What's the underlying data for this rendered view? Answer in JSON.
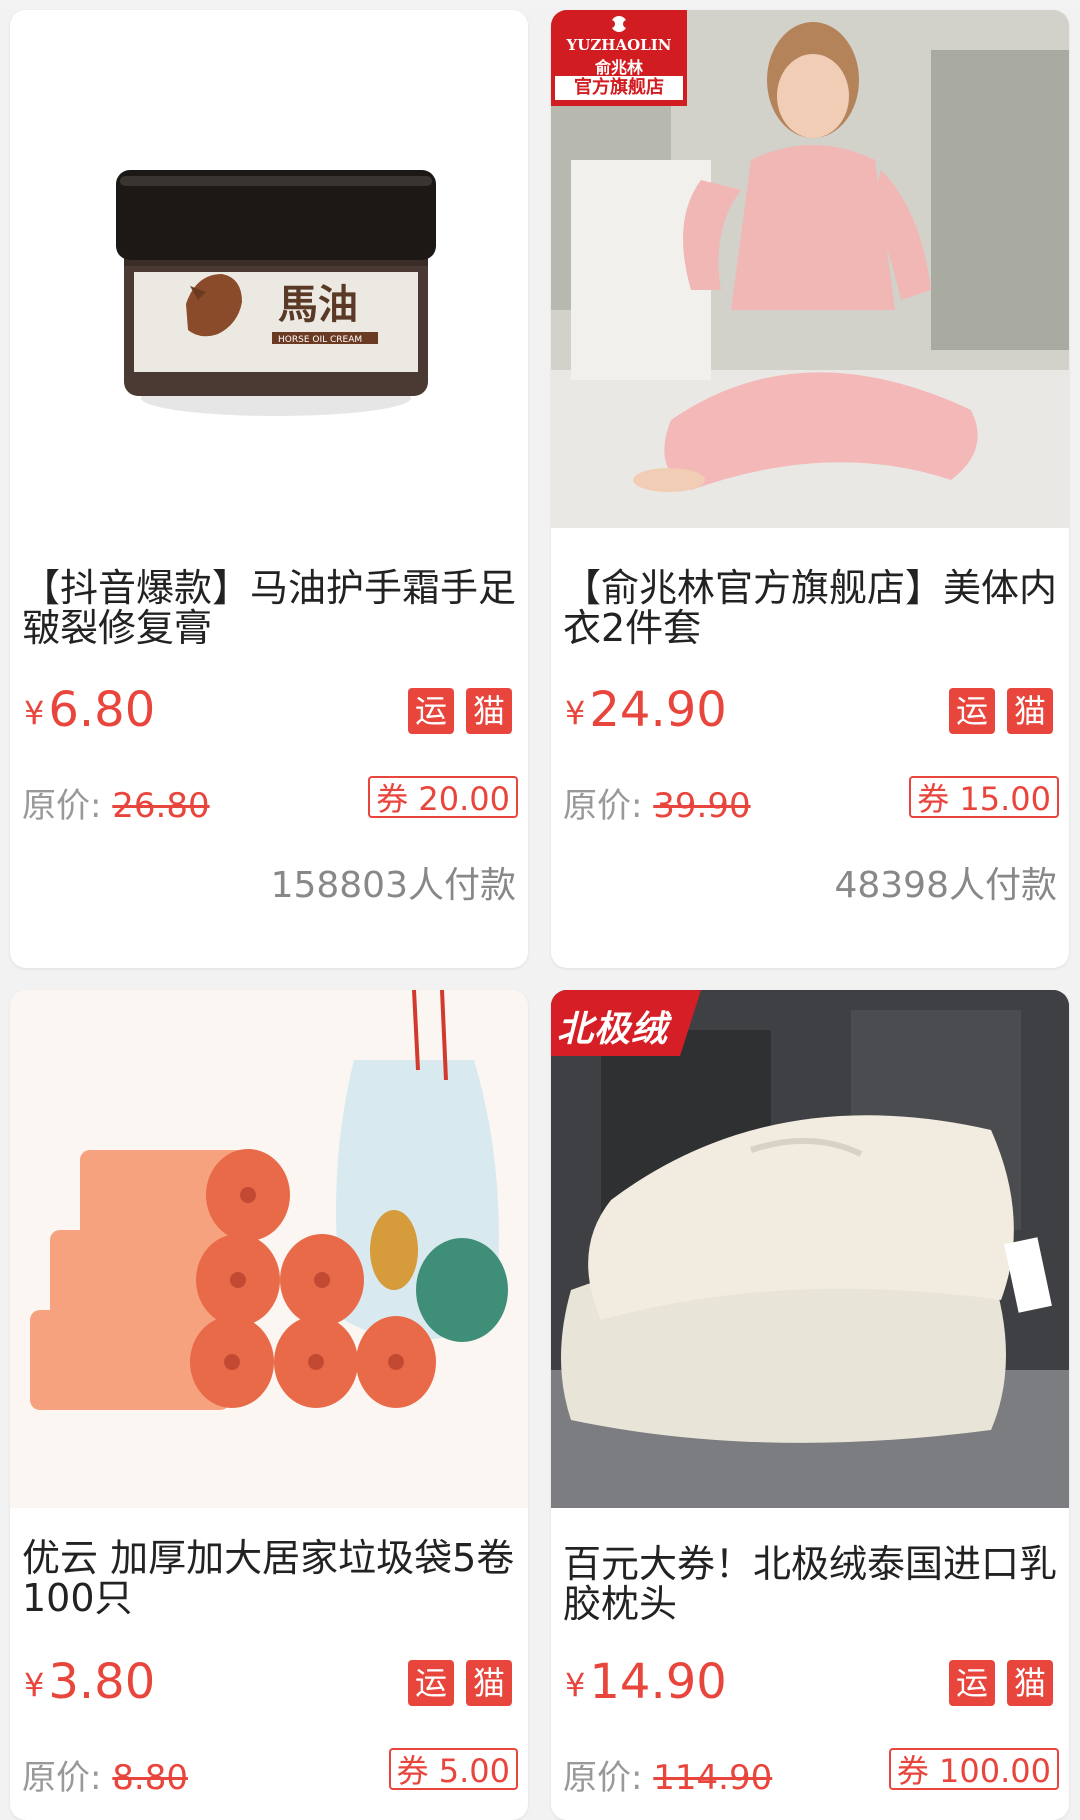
{
  "products": [
    {
      "title": "【抖音爆款】马油护手霜手足皲裂修复膏",
      "currency": "¥",
      "price": "6.80",
      "tags": [
        "运",
        "猫"
      ],
      "orig_label": "原价:",
      "orig_price": "26.80",
      "coupon": "券 20.00",
      "sales": "158803人付款",
      "image_text": "馬油",
      "image_subtext": "HORSE OIL CREAM"
    },
    {
      "title": "【俞兆林官方旗舰店】美体内衣2件套",
      "currency": "¥",
      "price": "24.90",
      "tags": [
        "运",
        "猫"
      ],
      "orig_label": "原价:",
      "orig_price": "39.90",
      "coupon": "券 15.00",
      "sales": "48398人付款",
      "brand_en": "YUZHAOLIN",
      "brand_cn": "俞兆林",
      "brand_store": "官方旗舰店"
    },
    {
      "title": "优云 加厚加大居家垃圾袋5卷100只",
      "currency": "¥",
      "price": "3.80",
      "tags": [
        "运",
        "猫"
      ],
      "orig_label": "原价:",
      "orig_price": "8.80",
      "coupon": "券 5.00"
    },
    {
      "title": "百元大券！北极绒泰国进口乳胶枕头",
      "currency": "¥",
      "price": "14.90",
      "tags": [
        "运",
        "猫"
      ],
      "orig_label": "原价:",
      "orig_price": "114.90",
      "coupon": "券 100.00",
      "brand": "北极绒"
    }
  ],
  "colors": {
    "accent": "#e8463d",
    "text": "#222222",
    "muted": "#999999",
    "background": "#f2f2f2"
  }
}
